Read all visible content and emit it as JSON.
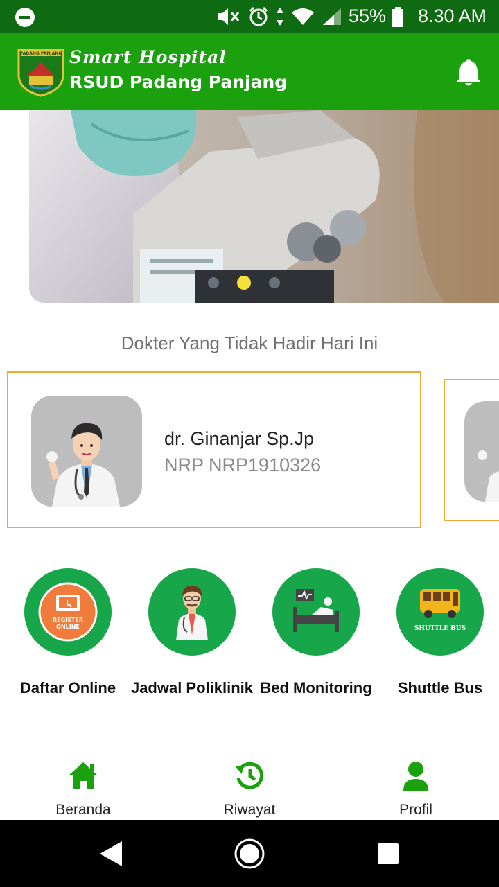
{
  "status_bar": {
    "battery_percent": "55%",
    "time": "8.30 AM"
  },
  "header": {
    "logo_text": "PADANG PANJANG",
    "brand_line1": "Smart Hospital",
    "brand_line2": "RSUD Padang Panjang",
    "bell_icon": "bell-icon"
  },
  "banner": {
    "slide_count": 3,
    "active_slide": 2
  },
  "absent_doctors": {
    "title": "Dokter Yang Tidak Hadir Hari Ini",
    "items": [
      {
        "name": "dr. Ginanjar Sp.Jp",
        "nrp": "NRP NRP1910326"
      }
    ]
  },
  "menu": {
    "items": [
      {
        "label": "Daftar Online",
        "badge_line1": "REGISTER",
        "badge_line2": "ONLINE",
        "icon": "register-online-icon"
      },
      {
        "label": "Jadwal Poliklinik",
        "icon": "doctor-icon"
      },
      {
        "label": "Bed Monitoring",
        "icon": "hospital-bed-icon"
      },
      {
        "label": "Shuttle Bus",
        "badge": "SHUTTLE BUS",
        "icon": "shuttle-bus-icon"
      }
    ]
  },
  "bottom_nav": {
    "items": [
      {
        "label": "Beranda",
        "icon": "home-icon"
      },
      {
        "label": "Riwayat",
        "icon": "history-icon"
      },
      {
        "label": "Profil",
        "icon": "profile-icon"
      }
    ]
  },
  "colors": {
    "status_bar": "#0f6b12",
    "app_bar": "#1aa10d",
    "menu_circle": "#18a64a",
    "card_border": "#f0a830",
    "active_dot": "#f5e13a"
  }
}
